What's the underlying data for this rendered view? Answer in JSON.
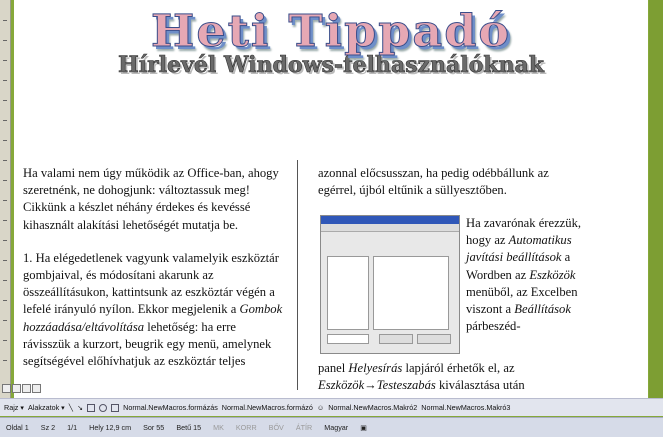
{
  "document": {
    "title": "Heti Tippadó",
    "subtitle": "Hírlevél Windows-felhasználóknak",
    "col1": {
      "p1": "Ha valami nem úgy működik az Office-ban, ahogy szeretnénk, ne dohogjunk: változtassuk meg! Cikkünk a készlet néhány érdekes és kevéssé kihasznált alakítási lehetőségét mutatja be.",
      "p2_a": "1. Ha elégedetlenek vagyunk valamelyik eszköztár gombjaival, és módosítani akarunk az összeállításukon, kattintsunk az eszköztár végén a lefelé irányuló nyílon. Ekkor megjelenik a ",
      "p2_em": "Gombok hozzáadása/eltávolítása",
      "p2_b": " lehetőség: ha erre rávisszük a kurzort, beugrik egy menü, amelynek segítségével előhívhatjuk az eszköztár teljes"
    },
    "col2": {
      "top": "azonnal előcsusszan, ha pedig odébbállunk az egérrel, újból eltűnik a süllyesztőben.",
      "side_a": "Ha zavarónak érezzük, hogy az ",
      "side_em1": "Automatikus javítási beállítások",
      "side_b": " a Wordben az ",
      "side_em2": "Eszközök",
      "side_c": " menüből, az Excelben viszont a ",
      "side_em3": "Beállítások",
      "side_d": " párbeszéd-",
      "bottom_a": "panel ",
      "bottom_em1": "Helyesírás",
      "bottom_b": " lapjáról érhetők el, az ",
      "bottom_em2": "Eszközök→Testeszabás",
      "bottom_c": " kiválasztása után"
    }
  },
  "toolbar": {
    "draw": "Rajz",
    "shapes": "Alakzatok",
    "macros": [
      "Normal.NewMacros.formázás",
      "Normal.NewMacros.formázó",
      "Normal.NewMacros.Makró2",
      "Normal.NewMacros.Makró3"
    ]
  },
  "status": {
    "page": "Oldal 1",
    "section": "Sz 2",
    "pages": "1/1",
    "position": "Hely 12,9 cm",
    "line": "Sor 55",
    "column": "Betű 15",
    "modes": [
      "MK",
      "KORR",
      "BŐV",
      "ÁTÍR"
    ],
    "language": "Magyar"
  },
  "colors": {
    "title_fill": "#e6a8b4",
    "title_outline": "#3a4d8a",
    "frame": "#86a83a"
  }
}
